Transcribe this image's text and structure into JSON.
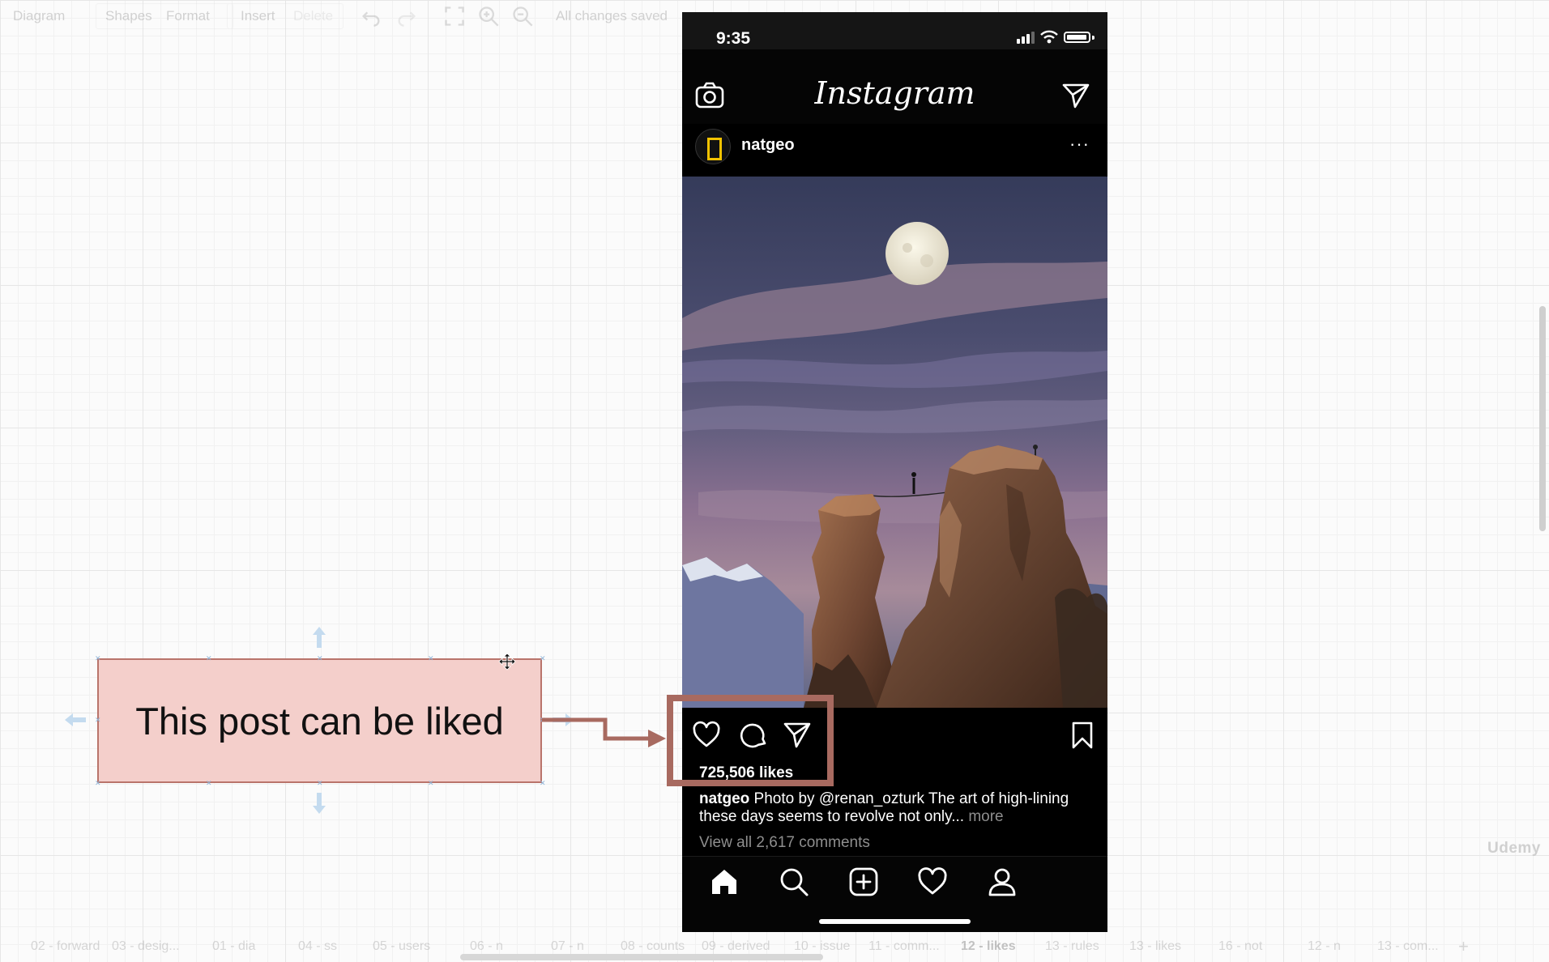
{
  "toolbar": {
    "menu_diagram": "Diagram",
    "menu_shapes": "Shapes",
    "menu_format": "Format",
    "menu_insert": "Insert",
    "menu_delete": "Delete",
    "status": "All changes saved",
    "icons": [
      "undo-icon",
      "redo-icon",
      "fullscreen-icon",
      "zoom-in-icon",
      "zoom-out-icon"
    ]
  },
  "note": {
    "text": "This post can be liked",
    "fill": "#f4cfcb",
    "border": "#b9746b"
  },
  "highlight_color": "#a86a60",
  "phone": {
    "status_time": "9:35",
    "app_title": "Instagram",
    "post": {
      "username": "natgeo",
      "more_label": "···",
      "likes": "725,506 likes",
      "caption_user": "natgeo",
      "caption_text": " Photo by @renan_ozturk  The art of high-lining these days seems to revolve not only...",
      "caption_more": " more",
      "view_comments": "View all 2,617 comments"
    }
  },
  "page_tabs": [
    "02 - forward",
    "03 - desig...",
    "01 - dia",
    "04 - ss",
    "05 - users",
    "06 - n",
    "07 - n",
    "08 - counts",
    "09 - derived",
    "10 - issue",
    "11 - comm...",
    "12 - likes",
    "13 - rules",
    "13 - likes",
    "16 - not",
    "12 - n",
    "13 - com..."
  ],
  "active_tab": "12 - likes",
  "watermark": "Udemy"
}
